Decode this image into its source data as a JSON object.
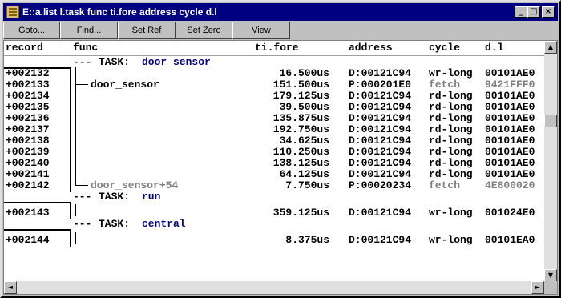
{
  "window": {
    "title": "E::a.list l.task func ti.fore address cycle d.l",
    "controls": {
      "minimize": "_",
      "maximize": "□",
      "close": "×"
    }
  },
  "toolbar": {
    "goto": "Goto...",
    "find": "Find...",
    "set_ref": "Set Ref",
    "set_zero": "Set Zero",
    "view": "View"
  },
  "columns": {
    "record": "record",
    "func": "func",
    "tifore": "ti.fore",
    "address": "address",
    "cycle": "cycle",
    "dl": "d.l"
  },
  "rows": [
    {
      "kind": "task",
      "label": "TASK:",
      "name": "door_sensor"
    },
    {
      "kind": "data",
      "record": "+002132",
      "func": "",
      "time": "16.500us",
      "address": "D:00121C94",
      "cycle": "wr-long",
      "data": "00101AE0"
    },
    {
      "kind": "data",
      "record": "+002133",
      "func": "door_sensor",
      "time": "151.500us",
      "address": "P:000201E0",
      "cycle": "fetch",
      "data": "9421FFF0",
      "fetch": true
    },
    {
      "kind": "data",
      "record": "+002134",
      "func": "",
      "time": "179.125us",
      "address": "D:00121C94",
      "cycle": "rd-long",
      "data": "00101AE0"
    },
    {
      "kind": "data",
      "record": "+002135",
      "func": "",
      "time": "39.500us",
      "address": "D:00121C94",
      "cycle": "rd-long",
      "data": "00101AE0"
    },
    {
      "kind": "data",
      "record": "+002136",
      "func": "",
      "time": "135.875us",
      "address": "D:00121C94",
      "cycle": "rd-long",
      "data": "00101AE0"
    },
    {
      "kind": "data",
      "record": "+002137",
      "func": "",
      "time": "192.750us",
      "address": "D:00121C94",
      "cycle": "rd-long",
      "data": "00101AE0"
    },
    {
      "kind": "data",
      "record": "+002138",
      "func": "",
      "time": "34.625us",
      "address": "D:00121C94",
      "cycle": "rd-long",
      "data": "00101AE0"
    },
    {
      "kind": "data",
      "record": "+002139",
      "func": "",
      "time": "110.250us",
      "address": "D:00121C94",
      "cycle": "rd-long",
      "data": "00101AE0"
    },
    {
      "kind": "data",
      "record": "+002140",
      "func": "",
      "time": "138.125us",
      "address": "D:00121C94",
      "cycle": "rd-long",
      "data": "00101AE0"
    },
    {
      "kind": "data",
      "record": "+002141",
      "func": "",
      "time": "64.125us",
      "address": "D:00121C94",
      "cycle": "rd-long",
      "data": "00101AE0"
    },
    {
      "kind": "data",
      "record": "+002142",
      "func": "door_sensor+54",
      "time": "7.750us",
      "address": "P:00020234",
      "cycle": "fetch",
      "data": "4E800020",
      "fetch": true
    },
    {
      "kind": "task",
      "label": "TASK:",
      "name": "run"
    },
    {
      "kind": "data",
      "record": "+002143",
      "func": "",
      "time": "359.125us",
      "address": "D:00121C94",
      "cycle": "wr-long",
      "data": "001024E0",
      "tall": true
    },
    {
      "kind": "task",
      "label": "TASK:",
      "name": "central"
    },
    {
      "kind": "data",
      "record": "+002144",
      "func": "",
      "time": "8.375us",
      "address": "D:00121C94",
      "cycle": "wr-long",
      "data": "00101EA0",
      "tall": true
    }
  ],
  "scroll": {
    "up": "▲",
    "down": "▼",
    "left": "◄",
    "right": "►"
  }
}
